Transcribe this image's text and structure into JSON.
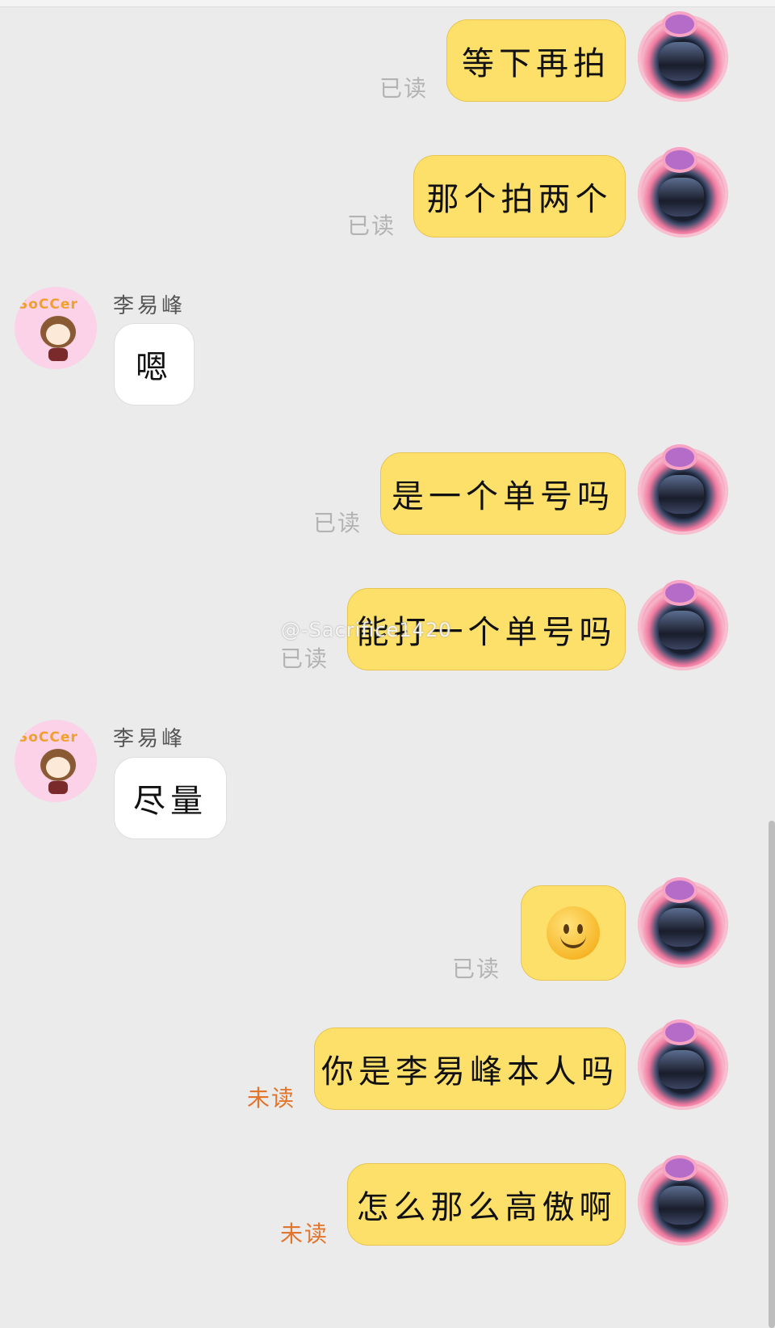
{
  "peer_name": "李易峰",
  "peer_avatar_text": "SoCCer",
  "watermark": "@-Sacrifice1420",
  "messages": [
    {
      "from": "me",
      "text": "等下再拍",
      "status": "已读"
    },
    {
      "from": "me",
      "text": "那个拍两个",
      "status": "已读"
    },
    {
      "from": "peer",
      "sender": "李易峰",
      "text": "嗯"
    },
    {
      "from": "me",
      "text": "是一个单号吗",
      "status": "已读"
    },
    {
      "from": "me",
      "text": "能打一个单号吗",
      "status": "已读"
    },
    {
      "from": "peer",
      "sender": "李易峰",
      "text": "尽量"
    },
    {
      "from": "me",
      "text": "",
      "emoji": "smile-emoji",
      "status": "已读"
    },
    {
      "from": "me",
      "text": "你是李易峰本人吗",
      "status": "未读"
    },
    {
      "from": "me",
      "text": "怎么那么高傲啊",
      "status": "未读"
    }
  ],
  "colors": {
    "background": "#ebebeb",
    "my_bubble": "#fde06a",
    "peer_bubble": "#ffffff",
    "read_status": "#b3b3b3",
    "unread_status": "#e2752c"
  }
}
